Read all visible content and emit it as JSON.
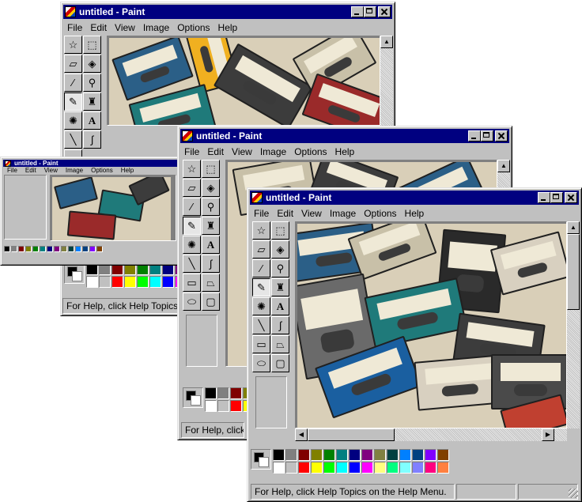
{
  "window": {
    "title": "untitled - Paint",
    "menus": [
      "File",
      "Edit",
      "View",
      "Image",
      "Options",
      "Help"
    ],
    "status_text": "For Help, click Help Topics on the Help Menu."
  },
  "icons": [
    "paint-app-icon",
    "minimize-icon",
    "maximize-icon",
    "close-icon",
    "free-form-select-icon",
    "rect-select-icon",
    "eraser-icon",
    "fill-icon",
    "color-picker-icon",
    "magnifier-icon",
    "pencil-icon",
    "brush-icon",
    "airbrush-icon",
    "text-icon",
    "line-icon",
    "curve-icon",
    "rectangle-icon",
    "polygon-icon",
    "ellipse-icon",
    "rounded-rect-icon"
  ],
  "palette": {
    "row1": [
      "#000000",
      "#808080",
      "#800000",
      "#808000",
      "#008000",
      "#008080",
      "#000080",
      "#800080",
      "#808040",
      "#004040",
      "#0080ff",
      "#004080",
      "#8000ff",
      "#804000"
    ],
    "row2": [
      "#ffffff",
      "#c0c0c0",
      "#ff0000",
      "#ffff00",
      "#00ff00",
      "#00ffff",
      "#0000ff",
      "#ff00ff",
      "#ffff80",
      "#00ff80",
      "#80ffff",
      "#8080ff",
      "#ff0080",
      "#ff8040"
    ]
  },
  "colors": {
    "titlebar": "#000080",
    "face": "#c0c0c0"
  }
}
